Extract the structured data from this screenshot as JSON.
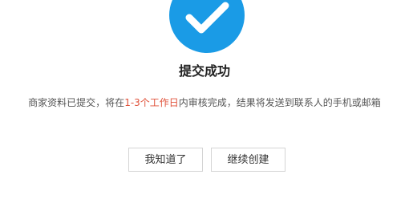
{
  "status": {
    "icon": "check-circle-icon",
    "icon_color": "#1a9be6",
    "title": "提交成功"
  },
  "message": {
    "prefix": "商家资料已提交，将在",
    "highlight": "1-3个工作日",
    "suffix": "内审核完成，结果将发送到联系人的手机或邮箱",
    "highlight_color": "#e0533b"
  },
  "actions": {
    "ok_label": "我知道了",
    "continue_label": "继续创建"
  }
}
